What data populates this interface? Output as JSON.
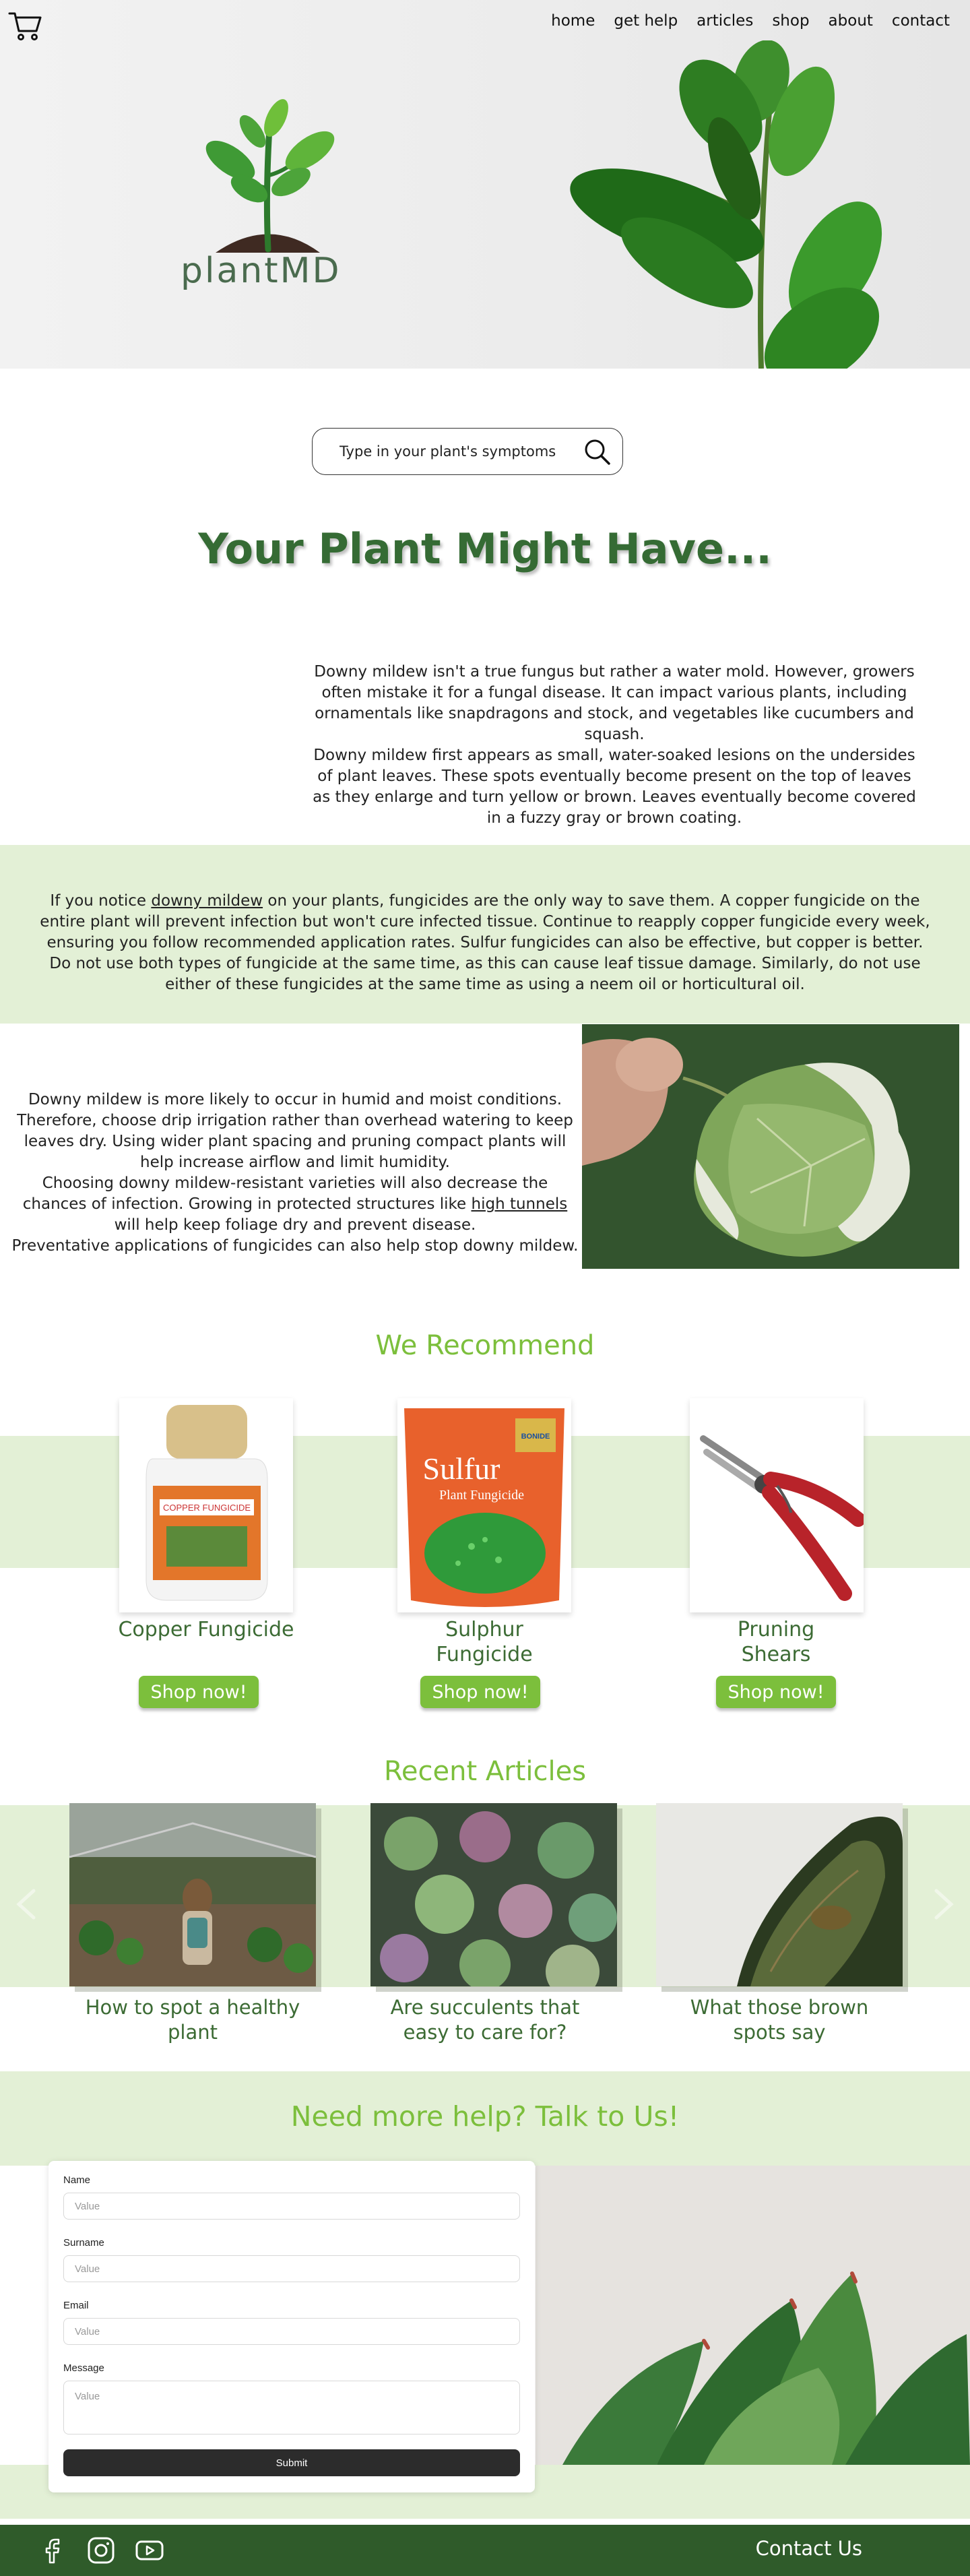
{
  "header": {
    "nav": [
      "home",
      "get help",
      "articles",
      "shop",
      "about",
      "contact"
    ],
    "logo_text": "plantMD"
  },
  "search": {
    "placeholder": "Type in your plant's symptoms"
  },
  "diagnosis": {
    "heading": "Your Plant Might Have...",
    "desc_1": "Downy mildew isn't a true fungus but rather a water mold. However, growers often mistake it for a fungal disease. It can impact various plants, including ornamentals like snapdragons and stock, and vegetables like cucumbers and squash.",
    "desc_2": "Downy mildew first appears as small, water-soaked lesions on the undersides of plant leaves. These spots eventually become present on the top of leaves as they enlarge and turn yellow or brown. Leaves eventually become covered in a fuzzy gray or brown coating.",
    "treat_pre": "If you notice ",
    "treat_link": "downy mildew",
    "treat_post": " on your plants, fungicides are the only way to save them. A copper fungicide on the entire plant will prevent infection but won't cure infected tissue. Continue to reapply copper fungicide every week, ensuring you follow recommended application rates. Sulfur fungicides can also be effective, but copper is better.",
    "treat_2": "Do not use both types of fungicide at the same time, as this can cause leaf tissue damage. Similarly, do not use either of these fungicides at the same time as using a neem oil or horticultural oil.",
    "prevent_1": "Downy mildew is more likely to occur in humid and moist conditions. Therefore, choose drip irrigation rather than overhead watering to keep leaves dry. Using wider plant spacing and pruning compact plants will help increase airflow and limit humidity.",
    "prevent_2_pre": "Choosing downy mildew-resistant varieties will also decrease the chances of infection. Growing in protected structures like ",
    "prevent_2_link": "high tunnels",
    "prevent_2_post": " will help keep foliage dry and prevent disease.",
    "prevent_3": "Preventative applications of fungicides can also help stop downy mildew."
  },
  "recommend": {
    "title": "We Recommend",
    "products": [
      {
        "name": "Copper Fungicide",
        "button": "Shop now!",
        "pack_text": "COPPER FUNGICIDE"
      },
      {
        "name": "Sulphur Fungicide",
        "button": "Shop now!",
        "pack_text": "Sulfur",
        "pack_sub": "Plant Fungicide",
        "pack_badge": "BONIDE"
      },
      {
        "name": "Pruning Shears",
        "button": "Shop now!"
      }
    ]
  },
  "articles": {
    "title": "Recent Articles",
    "items": [
      {
        "title": "How to spot a healthy plant"
      },
      {
        "title": "Are succulents that easy to care for?"
      },
      {
        "title": "What those brown spots say"
      }
    ]
  },
  "contact_form": {
    "title": "Need more help? Talk to Us!",
    "fields": [
      {
        "label": "Name",
        "placeholder": "Value"
      },
      {
        "label": "Surname",
        "placeholder": "Value"
      },
      {
        "label": "Email",
        "placeholder": "Value"
      },
      {
        "label": "Message",
        "placeholder": "Value"
      }
    ],
    "submit": "Submit"
  },
  "footer": {
    "contact": "Contact Us",
    "social_icons": [
      "facebook-icon",
      "instagram-icon",
      "youtube-icon"
    ],
    "bg_color": "#2f5b2a"
  },
  "colors": {
    "accent": "#7cbf3c",
    "dark_green": "#356b34",
    "band": "#e3f0d6"
  }
}
